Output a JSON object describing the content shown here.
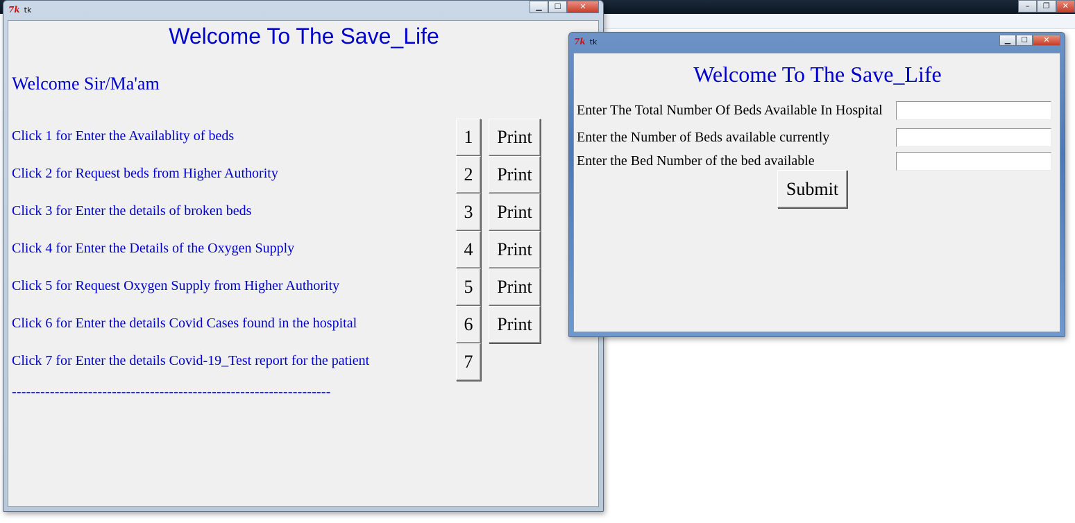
{
  "main_window": {
    "title": "tk",
    "heading": "Welcome To The Save_Life",
    "greeting": "Welcome Sir/Ma'am",
    "menu": [
      {
        "label": "Click 1 for Enter the Availablity of beds",
        "number": "1",
        "print": "Print"
      },
      {
        "label": "Click 2 for Request beds from Higher Authority",
        "number": "2",
        "print": "Print"
      },
      {
        "label": "Click 3 for Enter the details of broken beds",
        "number": "3",
        "print": "Print"
      },
      {
        "label": "Click 4 for Enter the Details of the Oxygen Supply",
        "number": "4",
        "print": "Print"
      },
      {
        "label": "Click 5 for Request Oxygen Supply from Higher Authority",
        "number": "5",
        "print": "Print"
      },
      {
        "label": "Click 6 for Enter the details Covid Cases found in the hospital",
        "number": "6",
        "print": "Print"
      },
      {
        "label": "Click 7 for Enter the details Covid-19_Test report for the patient",
        "number": "7"
      }
    ],
    "separator": "-------------------------------------------------------------------"
  },
  "dialog_window": {
    "title": "tk",
    "heading": "Welcome To The Save_Life",
    "fields": [
      {
        "label": "Enter The Total Number Of Beds Available In Hospital",
        "value": ""
      },
      {
        "label": "Enter the Number of Beds available currently",
        "value": ""
      },
      {
        "label": "Enter the Bed Number of the bed available",
        "value": ""
      }
    ],
    "submit_label": "Submit"
  },
  "colors": {
    "text_blue": "#0000cc",
    "window_bg": "#f0f0f0"
  }
}
